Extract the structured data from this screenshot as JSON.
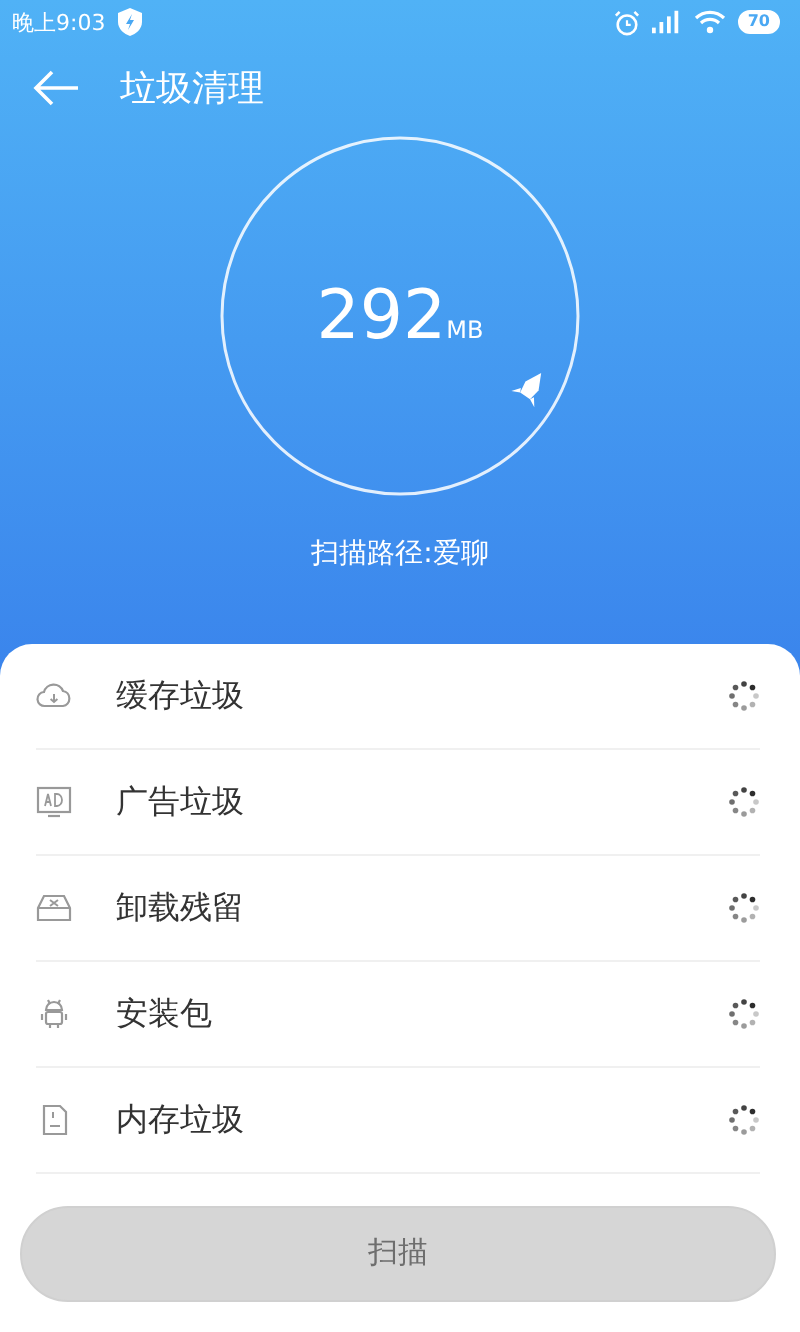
{
  "status_bar": {
    "time": "晚上9:03",
    "battery": "70"
  },
  "header": {
    "title": "垃圾清理"
  },
  "scan": {
    "size": "292",
    "unit": "MB",
    "path": "扫描路径:爱聊"
  },
  "items": [
    {
      "kind": "cache",
      "label": "缓存垃圾",
      "scanning": true
    },
    {
      "kind": "ad",
      "label": "广告垃圾",
      "scanning": true
    },
    {
      "kind": "uninstall",
      "label": "卸载残留",
      "scanning": true
    },
    {
      "kind": "package",
      "label": "安装包",
      "scanning": true
    },
    {
      "kind": "memory",
      "label": "内存垃圾",
      "scanning": true
    }
  ],
  "button": {
    "label": "扫描",
    "disabled": true
  }
}
